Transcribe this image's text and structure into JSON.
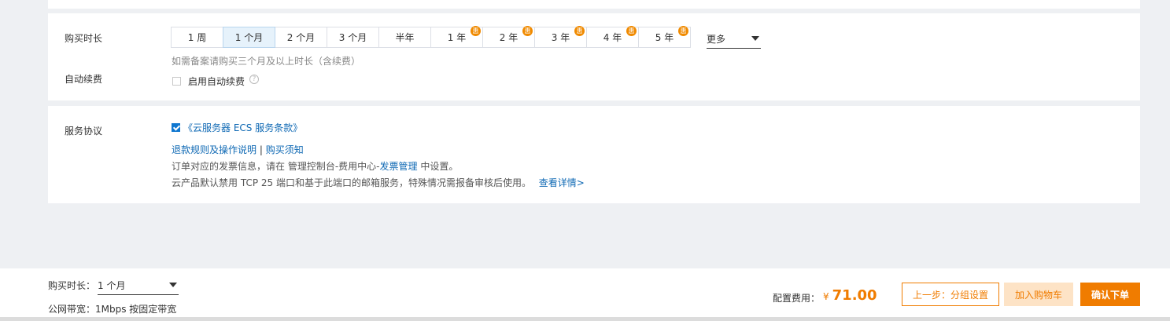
{
  "purchase": {
    "duration_label": "购买时长",
    "periods": [
      {
        "label": "1 周",
        "badge": ""
      },
      {
        "label": "1 个月",
        "badge": ""
      },
      {
        "label": "2 个月",
        "badge": ""
      },
      {
        "label": "3 个月",
        "badge": ""
      },
      {
        "label": "半年",
        "badge": ""
      },
      {
        "label": "1 年",
        "badge": "惠"
      },
      {
        "label": "2 年",
        "badge": "惠"
      },
      {
        "label": "3 年",
        "badge": "惠"
      },
      {
        "label": "4 年",
        "badge": "惠"
      },
      {
        "label": "5 年",
        "badge": "惠"
      }
    ],
    "selected_period": "1 个月",
    "more_label": "更多",
    "hint": "如需备案请购买三个月及以上时长（含续费）",
    "auto_renew_label": "自动续费",
    "auto_renew_checkbox_label": "启用自动续费",
    "auto_renew_checked": false,
    "help_icon_glyph": "?"
  },
  "service": {
    "label": "服务协议",
    "terms_checked": true,
    "terms_link": "《云服务器 ECS 服务条款》",
    "refund_link": "退款规则及操作说明",
    "separator": " | ",
    "purchase_notes_link": "购买须知",
    "invoice_prefix": "订单对应的发票信息，请在 管理控制台-费用中心-",
    "invoice_link": "发票管理",
    "invoice_suffix": " 中设置。",
    "notice_text": "云产品默认禁用 TCP 25 端口和基于此端口的邮箱服务，特殊情况需报备审核后使用。",
    "notice_link": "查看详情>"
  },
  "footer": {
    "duration_label": "购买时长：",
    "duration_value": "1 个月",
    "bandwidth_text": "公网带宽：1Mbps 按固定带宽",
    "cost_label": "配置费用：",
    "currency": "¥",
    "cost_value": "71.00",
    "prev_button": "上一步：分组设置",
    "cart_button": "加入购物车",
    "order_button": "确认下单"
  },
  "colors": {
    "accent_orange": "#f07c00",
    "link_blue": "#0f69b4",
    "selected_bg": "#e6f2fb"
  }
}
